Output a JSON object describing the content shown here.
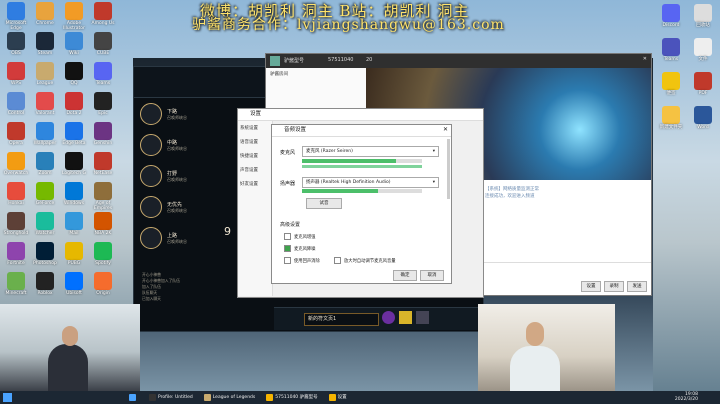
{
  "watermark": {
    "line1": "微博：胡凯利 洞主 B站：胡凯利 洞主",
    "line2": "驴酱商务合作：lvjiangshangwu@163.com"
  },
  "desktop_icons_left": [
    {
      "label": "Microsoft Edge",
      "color": "#2f7de1"
    },
    {
      "label": "Chrome",
      "color": "#e8a33d"
    },
    {
      "label": "Adobe Illustrator",
      "color": "#f29b25"
    },
    {
      "label": "Among Us",
      "color": "#c0392b"
    },
    {
      "label": "OBS",
      "color": "#2c3e50"
    },
    {
      "label": "Steam",
      "color": "#1b2838"
    },
    {
      "label": "Wiki",
      "color": "#3d8ad6"
    },
    {
      "label": "CUBE",
      "color": "#444"
    },
    {
      "label": "WPS",
      "color": "#d23b3b"
    },
    {
      "label": "League",
      "color": "#c8aa6e"
    },
    {
      "label": "QQ",
      "color": "#111"
    },
    {
      "label": "Teams",
      "color": "#5865f2"
    },
    {
      "label": "Control",
      "color": "#5b8bd4"
    },
    {
      "label": "Valorant",
      "color": "#e34b4b"
    },
    {
      "label": "Dota 2",
      "color": "#c33"
    },
    {
      "label": "Epic",
      "color": "#222"
    },
    {
      "label": "Opera",
      "color": "#c0392b"
    },
    {
      "label": "Wallpaper",
      "color": "#2e86de"
    },
    {
      "label": "Edge Beta",
      "color": "#1a73e8"
    },
    {
      "label": "Genshin",
      "color": "#6c3483"
    },
    {
      "label": "Overwatch",
      "color": "#f39c12"
    },
    {
      "label": "Zoom",
      "color": "#2980b9"
    },
    {
      "label": "Logitech G",
      "color": "#111"
    },
    {
      "label": "NetEase",
      "color": "#c0392b"
    },
    {
      "label": "Honkai",
      "color": "#e74c3c"
    },
    {
      "label": "GeForce",
      "color": "#76b900"
    },
    {
      "label": "Windows",
      "color": "#0078d7"
    },
    {
      "label": "Age of Empires",
      "color": "#8e6e3b"
    },
    {
      "label": "Stronghold",
      "color": "#5d4037"
    },
    {
      "label": "Watcher",
      "color": "#1abc9c"
    },
    {
      "label": "Mail",
      "color": "#3498db"
    },
    {
      "label": "NBA 2K",
      "color": "#d35400"
    },
    {
      "label": "Fortnite",
      "color": "#8e44ad"
    },
    {
      "label": "Photoshop",
      "color": "#001e36"
    },
    {
      "label": "PUBG",
      "color": "#e6b800"
    },
    {
      "label": "Spotify",
      "color": "#1db954"
    },
    {
      "label": "Minecraft",
      "color": "#6ab04c"
    },
    {
      "label": "Roblox",
      "color": "#222"
    },
    {
      "label": "Ubisoft",
      "color": "#0070ff"
    },
    {
      "label": "Origin",
      "color": "#f56c2d"
    },
    {
      "label": "Battle.net",
      "color": "#148eff"
    }
  ],
  "desktop_icons_right": [
    {
      "label": "Discord",
      "color": "#5865f2"
    },
    {
      "label": "回收站",
      "color": "#ddd"
    },
    {
      "label": "Teams",
      "color": "#4b53bc"
    },
    {
      "label": "文件",
      "color": "#eee"
    },
    {
      "label": "便签",
      "color": "#f1c40f"
    },
    {
      "label": "PDF",
      "color": "#c0392b"
    },
    {
      "label": "新建文件夹",
      "color": "#f5c242"
    },
    {
      "label": "Word",
      "color": "#2b579a"
    }
  ],
  "lol": {
    "side_items": [
      {
        "title": "下路",
        "sub": "召唤师峡谷"
      },
      {
        "title": "中路",
        "sub": "召唤师峡谷"
      },
      {
        "title": "打野",
        "sub": "召唤师峡谷"
      },
      {
        "title": "无优先",
        "sub": "召唤师峡谷"
      },
      {
        "title": "上路",
        "sub": "召唤师峡谷"
      }
    ],
    "count": "9",
    "chat_lines": [
      "开心小神兽",
      "开心小神兽加入了队伍",
      "加入了队伍",
      "队伍聊天",
      "已加入聊天"
    ],
    "bottom_input": "新的符文页1"
  },
  "yy": {
    "user": "驴酱型号",
    "id": "57511040",
    "members": "20",
    "channel": "驴酱房间",
    "chat_lines": [
      "【系统】网络质量监测正常",
      "连接成功，欢迎进入频道"
    ],
    "input_placeholder": "你可以开始输入",
    "buttons": [
      "设置",
      "录制",
      "发送"
    ]
  },
  "settings_dlg": {
    "title": "设置",
    "nav": [
      "系统设置",
      "语音设置",
      "快捷设置",
      "声音设置",
      "好友设置"
    ]
  },
  "audio_dlg": {
    "title": "音频设置",
    "mic_label": "麦克风",
    "mic_device": "麦克风 (Razer Seiren)",
    "spk_label": "扬声器",
    "spk_device": "扬声器 (Realtek High Definition Audio)",
    "test_btn": "试音",
    "section": "高级设置",
    "opts": [
      {
        "label": "麦克风增强",
        "checked": false
      },
      {
        "label": "麦克风降噪",
        "checked": true
      },
      {
        "label": "使用回声消除",
        "checked": false
      },
      {
        "label": "放大时自动调节麦克风音量",
        "checked": false
      }
    ],
    "ok": "确定",
    "cancel": "取消"
  },
  "taskbar": {
    "items": [
      {
        "label": "",
        "color": "#4aa3ff"
      },
      {
        "label": "Profile: Untitled",
        "color": "#333"
      },
      {
        "label": "League of Legends",
        "color": "#c8aa6e"
      },
      {
        "label": "57511040 驴酱型号",
        "color": "#f5b400"
      },
      {
        "label": "设置",
        "color": "#f5b400"
      }
    ],
    "time": "19:08",
    "date": "2022/3/20"
  }
}
